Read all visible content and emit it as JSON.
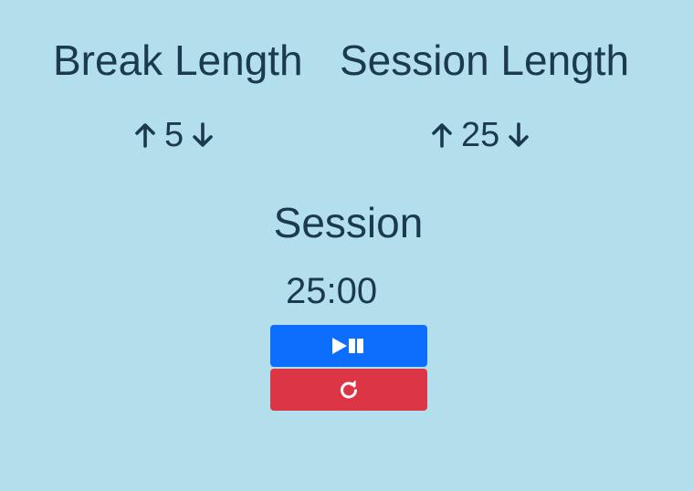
{
  "break": {
    "label": "Break Length",
    "value": "5",
    "increment_icon": "arrow-up-icon",
    "decrement_icon": "arrow-down-icon"
  },
  "session": {
    "label": "Session Length",
    "value": "25",
    "increment_icon": "arrow-up-icon",
    "decrement_icon": "arrow-down-icon"
  },
  "timer": {
    "label": "Session",
    "time_left": "25:00"
  },
  "controls": {
    "start_stop_icon": "play-pause-icon",
    "reset_icon": "refresh-icon"
  },
  "colors": {
    "background": "#b2dfeb",
    "text": "#1c3a4d",
    "start_stop_button": "#0d6efd",
    "reset_button": "#dc3545"
  }
}
